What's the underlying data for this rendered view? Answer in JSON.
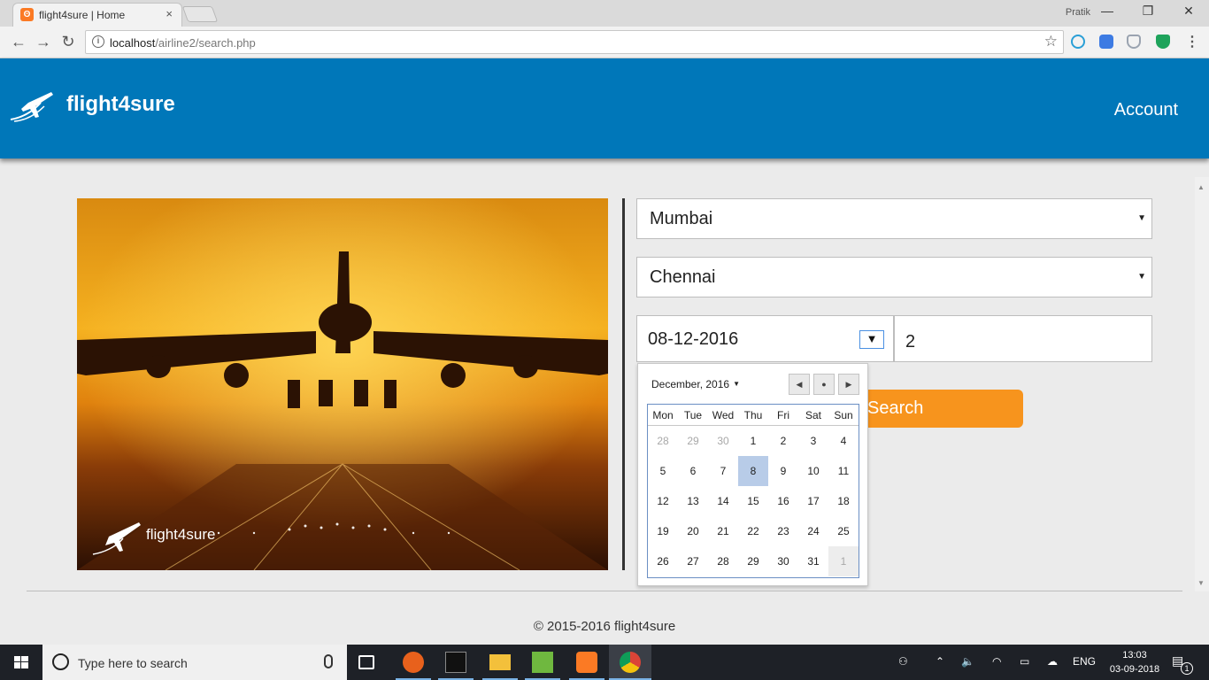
{
  "browser": {
    "tab_title": "flight4sure | Home",
    "tab_close": "×",
    "profile_name": "Pratik",
    "url_host": "localhost",
    "url_path": "/airline2/search.php"
  },
  "header": {
    "brand": "flight4sure",
    "account_label": "Account"
  },
  "hero": {
    "watermark": "flight4sure"
  },
  "form": {
    "from_city": "Mumbai",
    "to_city": "Chennai",
    "date": "08-12-2016",
    "passengers": "2",
    "search_label": "Search"
  },
  "calendar": {
    "month_label": "December, 2016",
    "weekdays": [
      "Mon",
      "Tue",
      "Wed",
      "Thu",
      "Fri",
      "Sat",
      "Sun"
    ],
    "weeks": [
      [
        "28",
        "29",
        "30",
        "1",
        "2",
        "3",
        "4"
      ],
      [
        "5",
        "6",
        "7",
        "8",
        "9",
        "10",
        "11"
      ],
      [
        "12",
        "13",
        "14",
        "15",
        "16",
        "17",
        "18"
      ],
      [
        "19",
        "20",
        "21",
        "22",
        "23",
        "24",
        "25"
      ],
      [
        "26",
        "27",
        "28",
        "29",
        "30",
        "31",
        "1"
      ]
    ],
    "selected_day": "8"
  },
  "footer": {
    "copyright": "© 2015-2016 flight4sure"
  },
  "taskbar": {
    "search_placeholder": "Type here to search",
    "language": "ENG",
    "time": "13:03",
    "date": "03-09-2018",
    "notification_count": "1"
  },
  "colors": {
    "header_blue": "#0077b9",
    "search_orange": "#f7941d",
    "selected_day": "#b8cce8"
  }
}
